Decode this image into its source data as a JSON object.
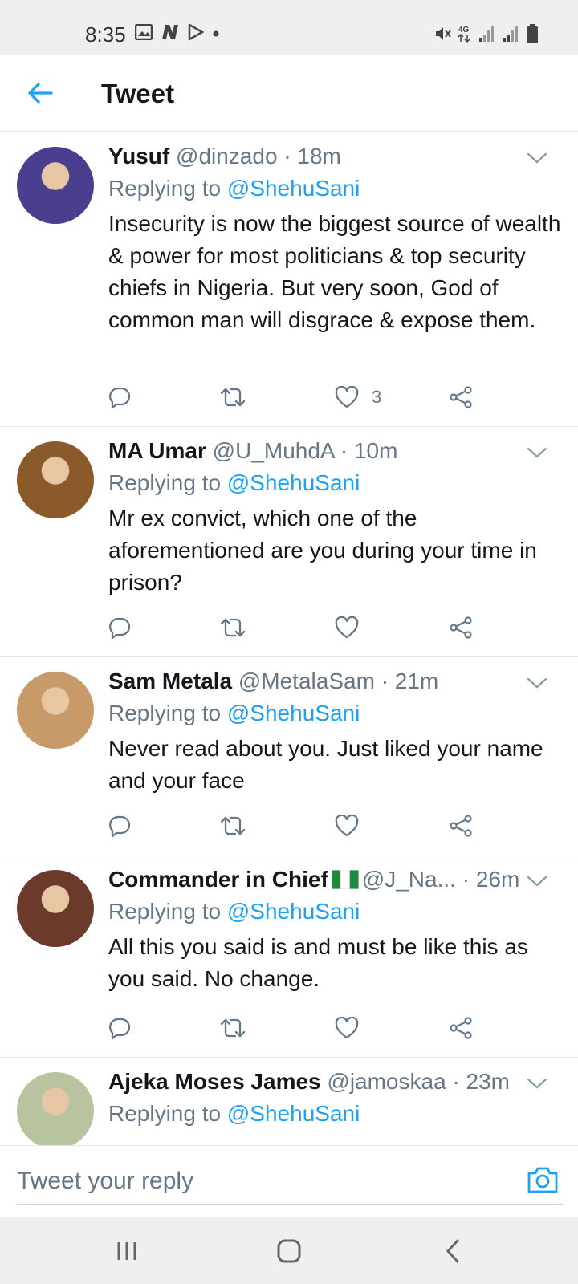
{
  "status_bar": {
    "time": "8:35",
    "left_icons": [
      "image-icon",
      "n-icon",
      "play-store-icon",
      "dot-icon"
    ],
    "right_icons": [
      "mute-icon",
      "4g-icon",
      "signal-icon",
      "signal-icon",
      "battery-icon"
    ],
    "network_label": "4G"
  },
  "header": {
    "title": "Tweet",
    "back_icon": "arrow-left-icon",
    "accent": "#1da1f2"
  },
  "tweets": [
    {
      "name": "Yusuf",
      "handle": "@dinzado",
      "time": "· 18m",
      "replying_prefix": "Replying to ",
      "replying_to": "@ShehuSani",
      "text": "Insecurity is now the biggest source of wealth & power for most politicians & top security chiefs in Nigeria. But very soon, God of common man will disgrace & expose them.",
      "likes": "3",
      "avatar_color": "#4a3f8f"
    },
    {
      "name": "MA Umar",
      "handle": "@U_MuhdA",
      "time": "· 10m",
      "replying_prefix": "Replying to ",
      "replying_to": "@ShehuSani",
      "text": "Mr ex convict, which one of the aforementioned are you during your time in prison?",
      "likes": "",
      "avatar_color": "#8a5a2b"
    },
    {
      "name": "Sam Metala",
      "handle": "@MetalaSam",
      "time": "· 21m",
      "replying_prefix": "Replying to ",
      "replying_to": "@ShehuSani",
      "text": "Never read about you. Just liked your name and your face",
      "likes": "",
      "avatar_color": "#c89a6a"
    },
    {
      "name": "Commander in Chief",
      "handle": "@J_Na...",
      "time": "· 26m",
      "replying_prefix": "Replying to ",
      "replying_to": "@ShehuSani",
      "text": "All this you said is and must be like this as you said. No change.",
      "likes": "",
      "avatar_color": "#6b3a2a",
      "flag": "nigeria-flag-icon"
    },
    {
      "name": "Ajeka Moses James",
      "handle": "@jamoskaa",
      "time": "· 23m",
      "replying_prefix": "Replying to ",
      "replying_to": "@ShehuSani",
      "text": "",
      "likes": "",
      "avatar_color": "#b8c4a0"
    }
  ],
  "action_icons": [
    "reply-icon",
    "retweet-icon",
    "like-icon",
    "share-icon"
  ],
  "composer": {
    "placeholder": "Tweet your reply",
    "camera_icon": "camera-icon"
  },
  "nav_bar": {
    "icons": [
      "recents-icon",
      "home-icon",
      "back-icon"
    ]
  }
}
